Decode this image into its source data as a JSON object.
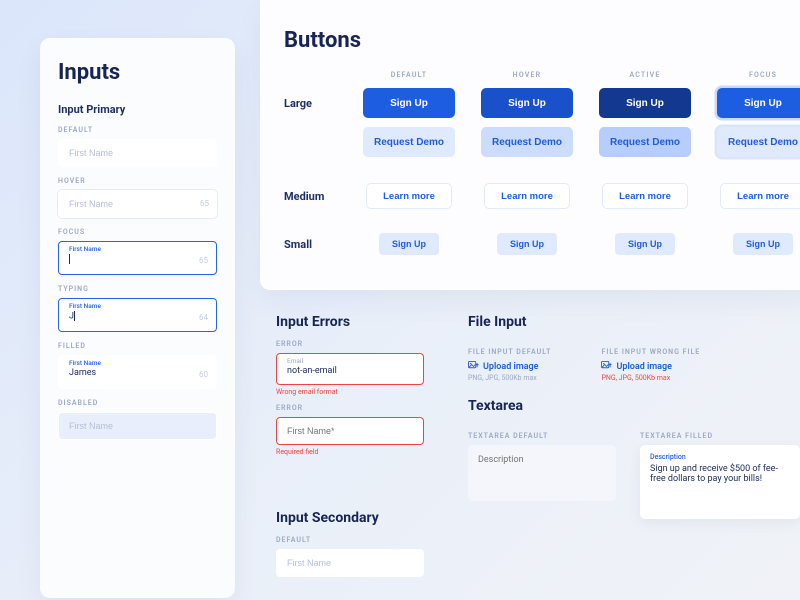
{
  "inputs": {
    "title": "Inputs",
    "section": "Input Primary",
    "states": {
      "default": {
        "label": "DEFAULT",
        "placeholder": "First Name"
      },
      "hover": {
        "label": "HOVER",
        "placeholder": "First Name",
        "count": "65"
      },
      "focus": {
        "label": "FOCUS",
        "float": "First Name",
        "count": "65"
      },
      "typing": {
        "label": "TYPING",
        "float": "First Name",
        "value": "J",
        "count": "64"
      },
      "filled": {
        "label": "FILLED",
        "float": "First Name",
        "value": "James",
        "count": "60"
      },
      "disabled": {
        "label": "DISABLED",
        "placeholder": "First Name"
      }
    }
  },
  "buttons": {
    "title": "Buttons",
    "cols": [
      "DEFAULT",
      "HOVER",
      "ACTIVE",
      "FOCUS"
    ],
    "rows": {
      "large": {
        "label": "Large",
        "primary": "Sign Up",
        "secondary": "Request Demo"
      },
      "medium": {
        "label": "Medium",
        "outline": "Learn more"
      },
      "small": {
        "label": "Small",
        "small": "Sign Up"
      }
    }
  },
  "errors": {
    "title": "Input Errors",
    "e1": {
      "label": "ERROR",
      "float": "Email",
      "value": "not-an-email",
      "msg": "Wrong email format"
    },
    "e2": {
      "label": "ERROR",
      "placeholder": "First Name*",
      "msg": "Required field"
    }
  },
  "secondary": {
    "title": "Input Secondary",
    "label": "DEFAULT",
    "placeholder": "First Name"
  },
  "file": {
    "title": "File Input",
    "default": {
      "label": "FILE INPUT DEFAULT",
      "link": "Upload image",
      "hint": "PNG, JPG, 500Kb max"
    },
    "wrong": {
      "label": "FILE INPUT WRONG FILE",
      "link": "Upload image",
      "hint": "PNG, JPG, 500Kb max"
    }
  },
  "textarea": {
    "title": "Textarea",
    "default": {
      "label": "TEXTAREA DEFAULT",
      "placeholder": "Description"
    },
    "filled": {
      "label": "TEXTAREA FILLED",
      "float": "Description",
      "value": "Sign up and receive $500 of fee-free dollars to pay your bills!"
    }
  }
}
